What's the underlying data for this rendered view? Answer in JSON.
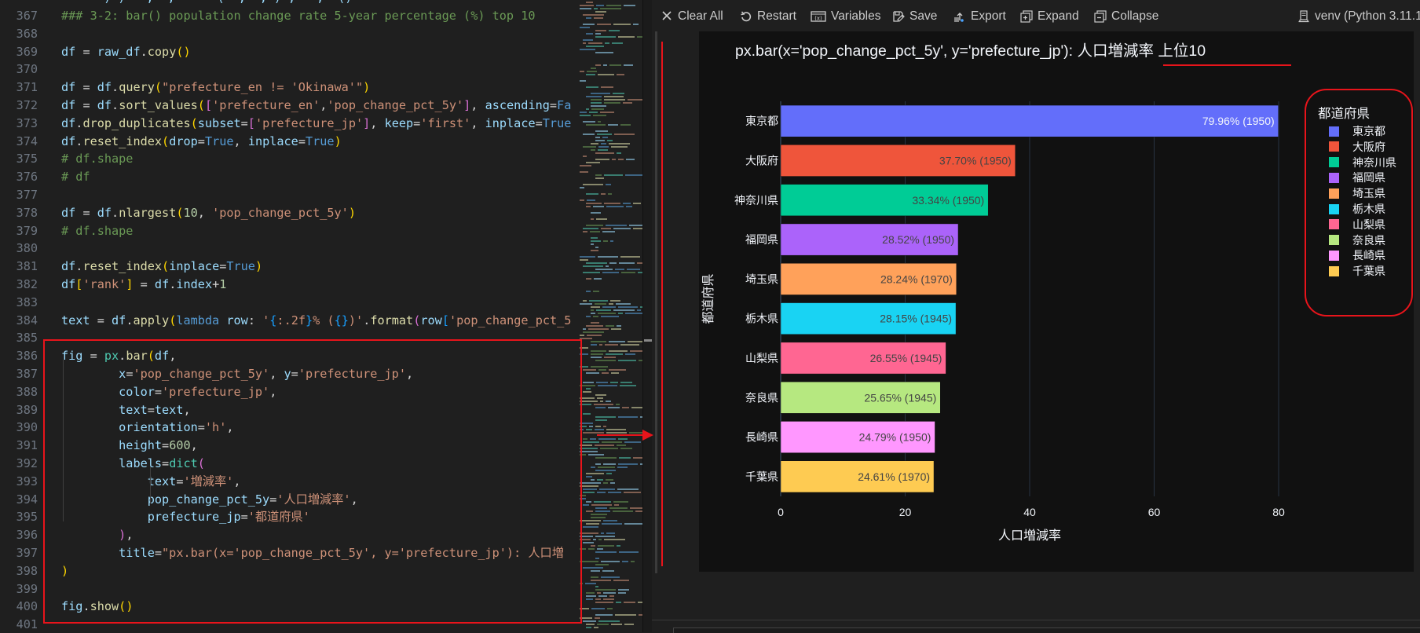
{
  "editor": {
    "top_partial": "      ) ) - ,  ,      (  ,  , ) ,   ,  ()",
    "lines": [
      {
        "n": "367",
        "tokens": [
          [
            "cm",
            "### 3-2: bar() population change rate 5-year percentage (%) top 10"
          ]
        ]
      },
      {
        "n": "368",
        "tokens": []
      },
      {
        "n": "369",
        "tokens": [
          [
            "v",
            "df"
          ],
          [
            "o",
            " = "
          ],
          [
            "v",
            "raw_df"
          ],
          [
            "o",
            "."
          ],
          [
            "f",
            "copy"
          ],
          [
            "p1",
            "()"
          ]
        ]
      },
      {
        "n": "370",
        "tokens": []
      },
      {
        "n": "371",
        "tokens": [
          [
            "v",
            "df"
          ],
          [
            "o",
            " = "
          ],
          [
            "v",
            "df"
          ],
          [
            "o",
            "."
          ],
          [
            "f",
            "query"
          ],
          [
            "p1",
            "("
          ],
          [
            "s",
            "\"prefecture_en != 'Okinawa'\""
          ],
          [
            "p1",
            ")"
          ]
        ]
      },
      {
        "n": "372",
        "tokens": [
          [
            "v",
            "df"
          ],
          [
            "o",
            " = "
          ],
          [
            "v",
            "df"
          ],
          [
            "o",
            "."
          ],
          [
            "f",
            "sort_values"
          ],
          [
            "p1",
            "("
          ],
          [
            "p2",
            "["
          ],
          [
            "s",
            "'prefecture_en'"
          ],
          [
            "o",
            ","
          ],
          [
            "s",
            "'pop_change_pct_5y'"
          ],
          [
            "p2",
            "]"
          ],
          [
            "o",
            ", "
          ],
          [
            "v",
            "ascending"
          ],
          [
            "o",
            "="
          ],
          [
            "k",
            "Fa"
          ]
        ]
      },
      {
        "n": "373",
        "tokens": [
          [
            "v",
            "df"
          ],
          [
            "o",
            "."
          ],
          [
            "f",
            "drop_duplicates"
          ],
          [
            "p1",
            "("
          ],
          [
            "v",
            "subset"
          ],
          [
            "o",
            "="
          ],
          [
            "p2",
            "["
          ],
          [
            "s",
            "'prefecture_jp'"
          ],
          [
            "p2",
            "]"
          ],
          [
            "o",
            ", "
          ],
          [
            "v",
            "keep"
          ],
          [
            "o",
            "="
          ],
          [
            "s",
            "'first'"
          ],
          [
            "o",
            ", "
          ],
          [
            "v",
            "inplace"
          ],
          [
            "o",
            "="
          ],
          [
            "k",
            "True"
          ]
        ]
      },
      {
        "n": "374",
        "tokens": [
          [
            "v",
            "df"
          ],
          [
            "o",
            "."
          ],
          [
            "f",
            "reset_index"
          ],
          [
            "p1",
            "("
          ],
          [
            "v",
            "drop"
          ],
          [
            "o",
            "="
          ],
          [
            "k",
            "True"
          ],
          [
            "o",
            ", "
          ],
          [
            "v",
            "inplace"
          ],
          [
            "o",
            "="
          ],
          [
            "k",
            "True"
          ],
          [
            "p1",
            ")"
          ]
        ]
      },
      {
        "n": "375",
        "tokens": [
          [
            "cm",
            "# df.shape"
          ]
        ]
      },
      {
        "n": "376",
        "tokens": [
          [
            "cm",
            "# df"
          ]
        ]
      },
      {
        "n": "377",
        "tokens": []
      },
      {
        "n": "378",
        "tokens": [
          [
            "v",
            "df"
          ],
          [
            "o",
            " = "
          ],
          [
            "v",
            "df"
          ],
          [
            "o",
            "."
          ],
          [
            "f",
            "nlargest"
          ],
          [
            "p1",
            "("
          ],
          [
            "n",
            "10"
          ],
          [
            "o",
            ", "
          ],
          [
            "s",
            "'pop_change_pct_5y'"
          ],
          [
            "p1",
            ")"
          ]
        ]
      },
      {
        "n": "379",
        "tokens": [
          [
            "cm",
            "# df.shape"
          ]
        ]
      },
      {
        "n": "380",
        "tokens": []
      },
      {
        "n": "381",
        "tokens": [
          [
            "v",
            "df"
          ],
          [
            "o",
            "."
          ],
          [
            "f",
            "reset_index"
          ],
          [
            "p1",
            "("
          ],
          [
            "v",
            "inplace"
          ],
          [
            "o",
            "="
          ],
          [
            "k",
            "True"
          ],
          [
            "p1",
            ")"
          ]
        ]
      },
      {
        "n": "382",
        "tokens": [
          [
            "v",
            "df"
          ],
          [
            "p1",
            "["
          ],
          [
            "s",
            "'rank'"
          ],
          [
            "p1",
            "]"
          ],
          [
            "o",
            " = "
          ],
          [
            "v",
            "df"
          ],
          [
            "o",
            "."
          ],
          [
            "v",
            "index"
          ],
          [
            "o",
            "+"
          ],
          [
            "n",
            "1"
          ]
        ]
      },
      {
        "n": "383",
        "tokens": []
      },
      {
        "n": "384",
        "tokens": [
          [
            "v",
            "text"
          ],
          [
            "o",
            " = "
          ],
          [
            "v",
            "df"
          ],
          [
            "o",
            "."
          ],
          [
            "f",
            "apply"
          ],
          [
            "p1",
            "("
          ],
          [
            "k",
            "lambda"
          ],
          [
            "o",
            " "
          ],
          [
            "v",
            "row"
          ],
          [
            "o",
            ": "
          ],
          [
            "s",
            "'"
          ],
          [
            "p3",
            "{"
          ],
          [
            "s",
            ":.2f"
          ],
          [
            "p3",
            "}"
          ],
          [
            "s",
            "% ("
          ],
          [
            "p3",
            "{}"
          ],
          [
            "s",
            ")'"
          ],
          [
            "o",
            "."
          ],
          [
            "f",
            "format"
          ],
          [
            "p2",
            "("
          ],
          [
            "v",
            "row"
          ],
          [
            "p3",
            "["
          ],
          [
            "s",
            "'pop_change_pct_5"
          ]
        ]
      },
      {
        "n": "385",
        "tokens": []
      },
      {
        "n": "386",
        "tokens": [
          [
            "v",
            "fig"
          ],
          [
            "o",
            " = "
          ],
          [
            "m",
            "px"
          ],
          [
            "o",
            "."
          ],
          [
            "f",
            "bar"
          ],
          [
            "p1",
            "("
          ],
          [
            "v",
            "df"
          ],
          [
            "o",
            ","
          ]
        ]
      },
      {
        "n": "387",
        "tokens": [
          [
            "o",
            "        "
          ],
          [
            "v",
            "x"
          ],
          [
            "o",
            "="
          ],
          [
            "s",
            "'pop_change_pct_5y'"
          ],
          [
            "o",
            ", "
          ],
          [
            "v",
            "y"
          ],
          [
            "o",
            "="
          ],
          [
            "s",
            "'prefecture_jp'"
          ],
          [
            "o",
            ","
          ]
        ]
      },
      {
        "n": "388",
        "tokens": [
          [
            "o",
            "        "
          ],
          [
            "v",
            "color"
          ],
          [
            "o",
            "="
          ],
          [
            "s",
            "'prefecture_jp'"
          ],
          [
            "o",
            ","
          ]
        ]
      },
      {
        "n": "389",
        "tokens": [
          [
            "o",
            "        "
          ],
          [
            "v",
            "text"
          ],
          [
            "o",
            "="
          ],
          [
            "v",
            "text"
          ],
          [
            "o",
            ","
          ]
        ]
      },
      {
        "n": "390",
        "tokens": [
          [
            "o",
            "        "
          ],
          [
            "v",
            "orientation"
          ],
          [
            "o",
            "="
          ],
          [
            "s",
            "'h'"
          ],
          [
            "o",
            ","
          ]
        ]
      },
      {
        "n": "391",
        "tokens": [
          [
            "o",
            "        "
          ],
          [
            "v",
            "height"
          ],
          [
            "o",
            "="
          ],
          [
            "n",
            "600"
          ],
          [
            "o",
            ","
          ]
        ]
      },
      {
        "n": "392",
        "tokens": [
          [
            "o",
            "        "
          ],
          [
            "v",
            "labels"
          ],
          [
            "o",
            "="
          ],
          [
            "m",
            "dict"
          ],
          [
            "p2",
            "("
          ]
        ]
      },
      {
        "n": "393",
        "tokens": [
          [
            "o",
            "            "
          ],
          [
            "v",
            "text"
          ],
          [
            "o",
            "="
          ],
          [
            "s",
            "'増減率'"
          ],
          [
            "o",
            ","
          ]
        ]
      },
      {
        "n": "394",
        "tokens": [
          [
            "o",
            "            "
          ],
          [
            "v",
            "pop_change_pct_5y"
          ],
          [
            "o",
            "="
          ],
          [
            "s",
            "'人口増減率'"
          ],
          [
            "o",
            ","
          ]
        ]
      },
      {
        "n": "395",
        "tokens": [
          [
            "o",
            "            "
          ],
          [
            "v",
            "prefecture_jp"
          ],
          [
            "o",
            "="
          ],
          [
            "s",
            "'都道府県'"
          ]
        ]
      },
      {
        "n": "396",
        "tokens": [
          [
            "o",
            "        "
          ],
          [
            "p2",
            ")"
          ],
          [
            "o",
            ","
          ]
        ]
      },
      {
        "n": "397",
        "tokens": [
          [
            "o",
            "        "
          ],
          [
            "v",
            "title"
          ],
          [
            "o",
            "="
          ],
          [
            "s",
            "\"px.bar(x='pop_change_pct_5y', y='prefecture_jp'): 人口増"
          ]
        ]
      },
      {
        "n": "398",
        "tokens": [
          [
            "p1",
            ")"
          ]
        ]
      },
      {
        "n": "399",
        "tokens": []
      },
      {
        "n": "400",
        "tokens": [
          [
            "v",
            "fig"
          ],
          [
            "o",
            "."
          ],
          [
            "f",
            "show"
          ],
          [
            "p1",
            "()"
          ]
        ]
      },
      {
        "n": "401",
        "tokens": []
      }
    ]
  },
  "toolbar": {
    "clear_all": "Clear All",
    "restart": "Restart",
    "variables": "Variables",
    "save": "Save",
    "export": "Export",
    "expand": "Expand",
    "collapse": "Collapse",
    "kernel": "venv (Python 3.11.1"
  },
  "chart_data": {
    "type": "bar",
    "orientation": "h",
    "title": "px.bar(x='pop_change_pct_5y', y='prefecture_jp'): 人口増減率 上位10",
    "xlabel": "人口増減率",
    "ylabel": "都道府県",
    "xlim": [
      0,
      80
    ],
    "xticks": [
      0,
      20,
      40,
      60,
      80
    ],
    "grid": true,
    "legend_title": "都道府県",
    "legend_position": "right",
    "categories": [
      "東京都",
      "大阪府",
      "神奈川県",
      "福岡県",
      "埼玉県",
      "栃木県",
      "山梨県",
      "奈良県",
      "長崎県",
      "千葉県"
    ],
    "values": [
      79.96,
      37.7,
      33.34,
      28.52,
      28.24,
      28.15,
      26.55,
      25.65,
      24.79,
      24.61
    ],
    "text_labels": [
      "79.96% (1950)",
      "37.70% (1950)",
      "33.34% (1950)",
      "28.52% (1950)",
      "28.24% (1970)",
      "28.15% (1945)",
      "26.55% (1945)",
      "25.65% (1945)",
      "24.79% (1950)",
      "24.61% (1970)"
    ],
    "colors": [
      "#636efa",
      "#ef553b",
      "#00cc96",
      "#ab63fa",
      "#ffa15a",
      "#19d3f3",
      "#ff6692",
      "#b6e880",
      "#ff97ff",
      "#fecb52"
    ]
  },
  "colors": {
    "annotation_red": "#e8141b",
    "plot_bg": "#111111",
    "editor_bg": "#1f1f1f"
  }
}
